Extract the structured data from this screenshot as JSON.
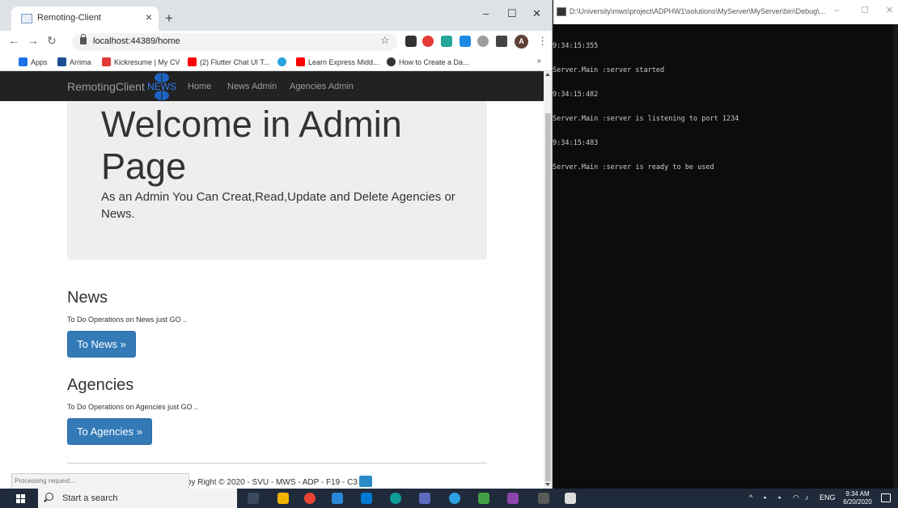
{
  "browser": {
    "tab_title": "Remoting-Client",
    "tab_close": "×",
    "new_tab": "+",
    "url": "localhost:44389/home",
    "avatar_letter": "A",
    "controls": {
      "minimize": "–",
      "maximize": "☐",
      "close": "✕"
    },
    "bookmarks": [
      {
        "label": "Apps",
        "icon_color": "#1a73e8"
      },
      {
        "label": "Arrima",
        "icon_color": "#1d4f91"
      },
      {
        "label": "Kickresume | My CV",
        "icon_color": "#e53935"
      },
      {
        "label": "(2) Flutter Chat UI T...",
        "icon_color": "#ff0000"
      },
      {
        "label": "",
        "icon_color": "#2aa3e0"
      },
      {
        "label": "Learn Express Midd...",
        "icon_color": "#ff0000"
      },
      {
        "label": "How to Create a Da...",
        "icon_color": "#333333"
      }
    ],
    "bookmarks_more": "»",
    "status_text": "Processing request..."
  },
  "site": {
    "brand": "RemotingClient",
    "logo_text": "NEWS",
    "nav": [
      "Home",
      "News Admin",
      "Agencies Admin"
    ],
    "jumbotron": {
      "title": "Welcome in Admin Page",
      "lead": "As an Admin You Can Creat,Read,Update and Delete Agencies or News."
    },
    "news": {
      "heading": "News",
      "text": "To Do Operations on News just GO ..",
      "button": "To News »"
    },
    "agencies": {
      "heading": "Agencies",
      "text": "To Do Operations on Agencies just GO ..",
      "button": "To Agencies »"
    },
    "footer": "Copy Right © 2020 - SVU - MWS - ADP - F19 - C3"
  },
  "console": {
    "title": "D:\\University\\mws\\project\\ADPHW1\\solutions\\MyServer\\MyServer\\bin\\Debug\\...",
    "lines": [
      "9:34:15:355",
      "Server.Main :server started",
      "9:34:15:482",
      "Server.Main :server is listening to port 1234",
      "9:34:15:483",
      "Server.Main :server is ready to be used"
    ],
    "controls": {
      "minimize": "–",
      "maximize": "☐",
      "close": "✕"
    }
  },
  "taskbar": {
    "search_placeholder": "Start a search",
    "tray_lang": "ENG",
    "time": "9:34 AM",
    "date": "6/20/2020"
  },
  "colors": {
    "navbar": "#222222",
    "primary_button": "#337ab7",
    "jumbotron": "#eeeeee",
    "console_bg": "#0c0c0c",
    "taskbar": "#1f2a3a"
  }
}
